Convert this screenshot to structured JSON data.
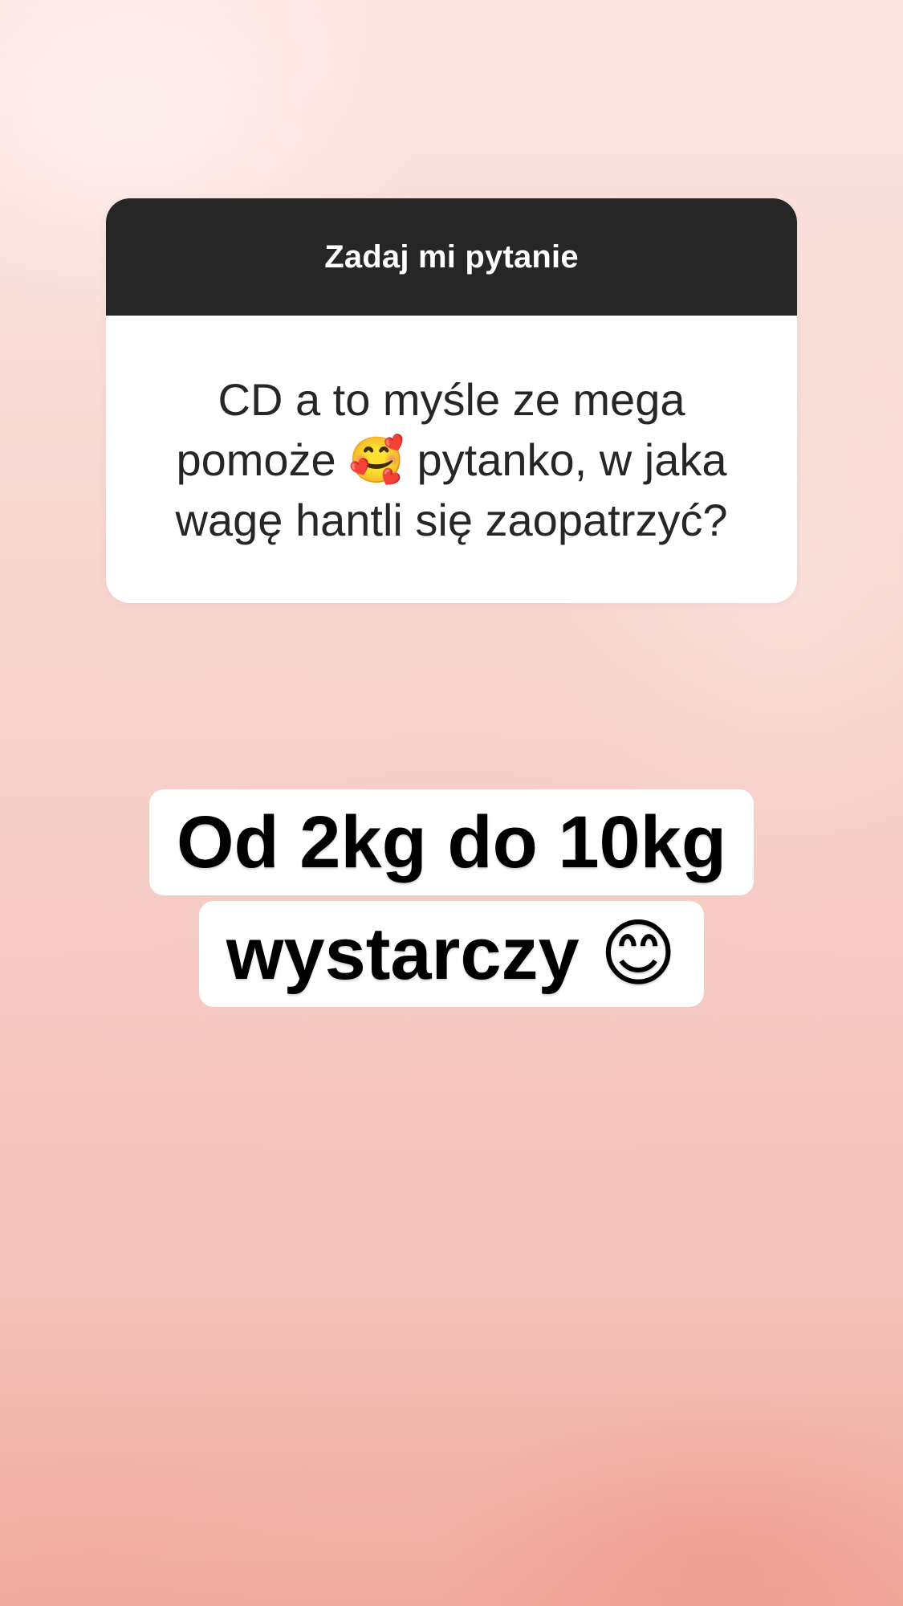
{
  "question_sticker": {
    "header": "Zadaj mi pytanie",
    "question": "CD a to myśle ze mega pomoże 🥰 pytanko, w jaka wagę hantli się zaopatrzyć?"
  },
  "answer": {
    "line1": "Od 2kg do 10kg",
    "line2": "wystarczy 😊"
  },
  "colors": {
    "header_background": "#262626",
    "card_background": "#ffffff",
    "background_top": "#fbe6e3",
    "background_bottom": "#f0ab9f"
  }
}
